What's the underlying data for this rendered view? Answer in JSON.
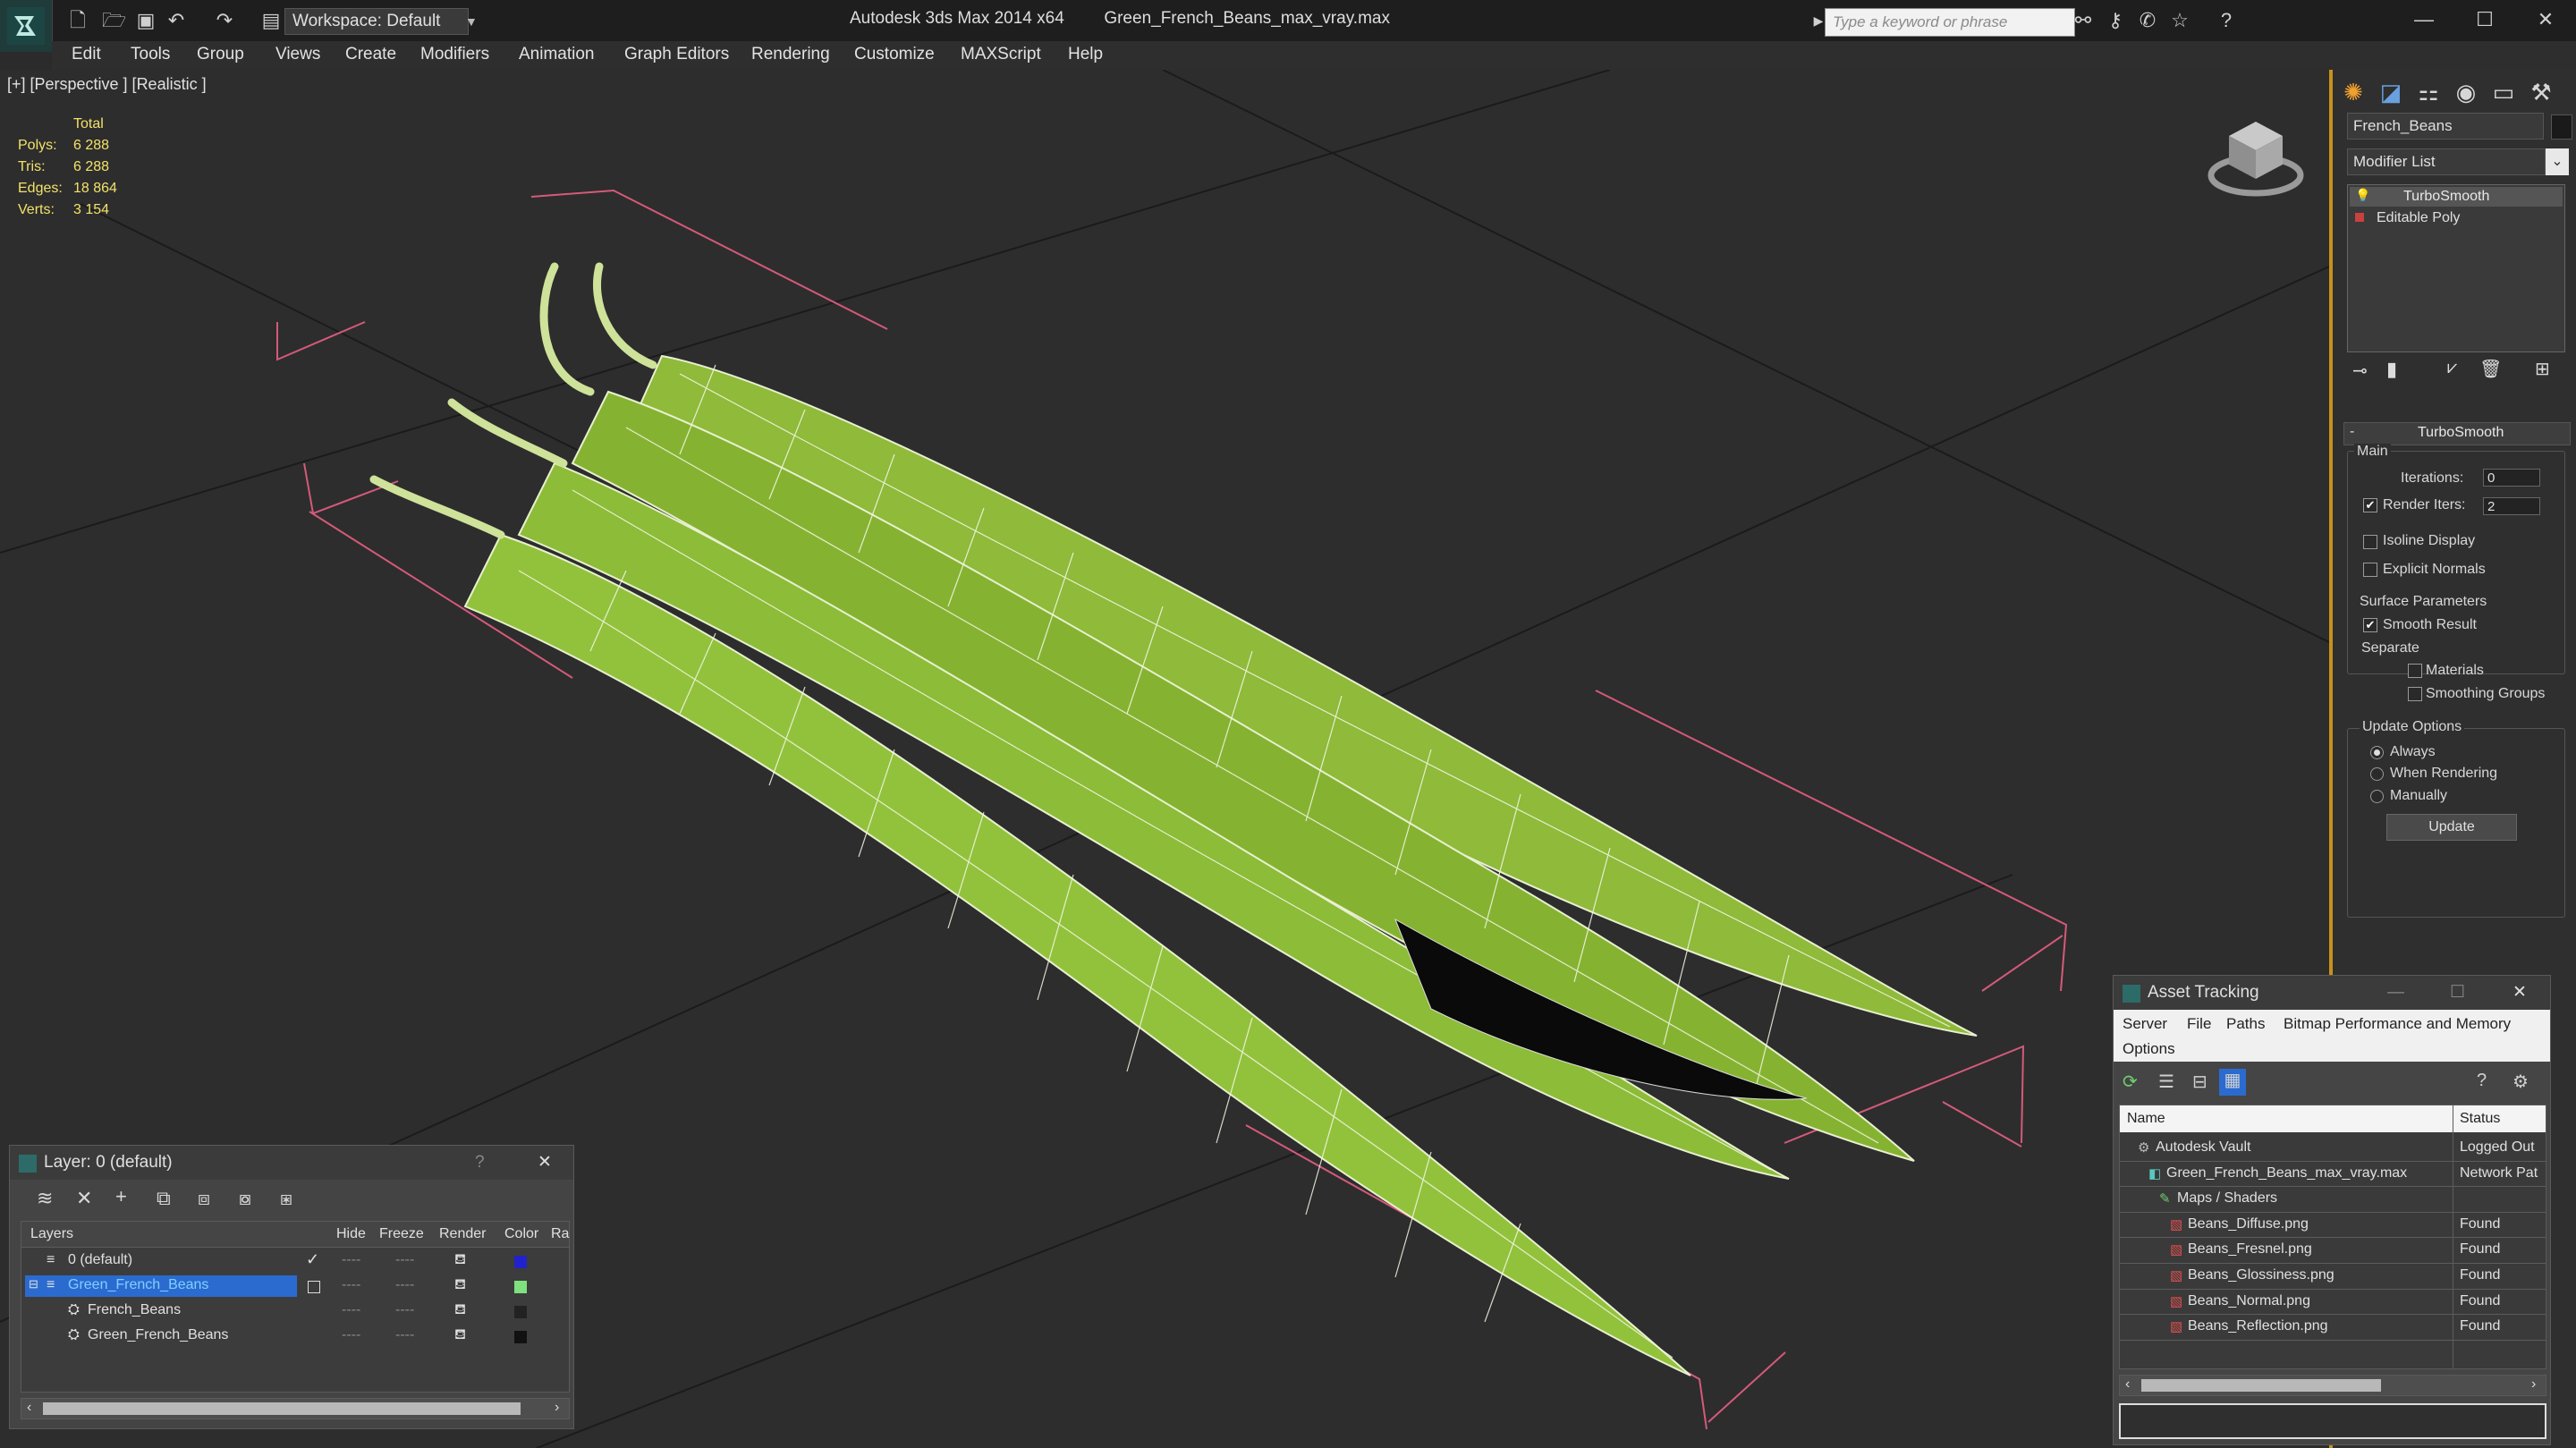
{
  "titlebar": {
    "workspace": "Workspace: Default",
    "app_title": "Autodesk 3ds Max  2014 x64",
    "file_title": "Green_French_Beans_max_vray.max",
    "search_placeholder": "Type a keyword or phrase"
  },
  "menu": [
    "Edit",
    "Tools",
    "Group",
    "Views",
    "Create",
    "Modifiers",
    "Animation",
    "Graph Editors",
    "Rendering",
    "Customize",
    "MAXScript",
    "Help"
  ],
  "viewport": {
    "label": "[+] [Perspective ] [Realistic ]",
    "stats": {
      "total_label": "Total",
      "rows": [
        {
          "label": "Polys:",
          "value": "6 288"
        },
        {
          "label": "Tris:",
          "value": "6 288"
        },
        {
          "label": "Edges:",
          "value": "18 864"
        },
        {
          "label": "Verts:",
          "value": "3 154"
        }
      ]
    }
  },
  "command_panel": {
    "object_name": "French_Beans",
    "modifier_list": "Modifier List",
    "stack": [
      "TurboSmooth",
      "Editable Poly"
    ],
    "rollout_title": "TurboSmooth",
    "main_label": "Main",
    "iterations_label": "Iterations:",
    "iterations_value": "0",
    "render_iters_label": "Render Iters:",
    "render_iters_value": "2",
    "render_iters_checked": true,
    "isoline_label": "Isoline Display",
    "explicit_normals_label": "Explicit Normals",
    "surface_params_label": "Surface Parameters",
    "smooth_result_label": "Smooth Result",
    "smooth_result_checked": true,
    "separate_label": "Separate",
    "materials_label": "Materials",
    "smoothing_groups_label": "Smoothing Groups",
    "update_options_label": "Update Options",
    "always_label": "Always",
    "when_rendering_label": "When Rendering",
    "manually_label": "Manually",
    "update_button": "Update"
  },
  "layer_panel": {
    "title": "Layer: 0 (default)",
    "help": "?",
    "columns": [
      "Layers",
      "Hide",
      "Freeze",
      "Render",
      "Color",
      "Ra"
    ],
    "rows": [
      {
        "name": "0 (default)",
        "color": "#2222cc",
        "selected": false,
        "indent": 0
      },
      {
        "name": "Green_French_Beans",
        "color": "#7fe07f",
        "selected": true,
        "indent": 0
      },
      {
        "name": "French_Beans",
        "color": "#222222",
        "selected": false,
        "indent": 1
      },
      {
        "name": "Green_French_Beans",
        "color": "#111111",
        "selected": false,
        "indent": 1
      }
    ]
  },
  "asset_panel": {
    "title": "Asset Tracking",
    "menu": [
      "Server",
      "File",
      "Paths",
      "Bitmap Performance and Memory",
      "Options"
    ],
    "columns": [
      "Name",
      "Status"
    ],
    "rows": [
      {
        "name": "Autodesk Vault",
        "status": "Logged Out",
        "indent": 1,
        "icon": "vault-icon"
      },
      {
        "name": "Green_French_Beans_max_vray.max",
        "status": "Network Pat",
        "indent": 2,
        "icon": "max-file-icon"
      },
      {
        "name": "Maps / Shaders",
        "status": "",
        "indent": 3,
        "icon": "maps-icon"
      },
      {
        "name": "Beans_Diffuse.png",
        "status": "Found",
        "indent": 4,
        "icon": "png-file-icon"
      },
      {
        "name": "Beans_Fresnel.png",
        "status": "Found",
        "indent": 4,
        "icon": "png-file-icon"
      },
      {
        "name": "Beans_Glossiness.png",
        "status": "Found",
        "indent": 4,
        "icon": "png-file-icon"
      },
      {
        "name": "Beans_Normal.png",
        "status": "Found",
        "indent": 4,
        "icon": "png-file-icon"
      },
      {
        "name": "Beans_Reflection.png",
        "status": "Found",
        "indent": 4,
        "icon": "png-file-icon"
      }
    ]
  }
}
